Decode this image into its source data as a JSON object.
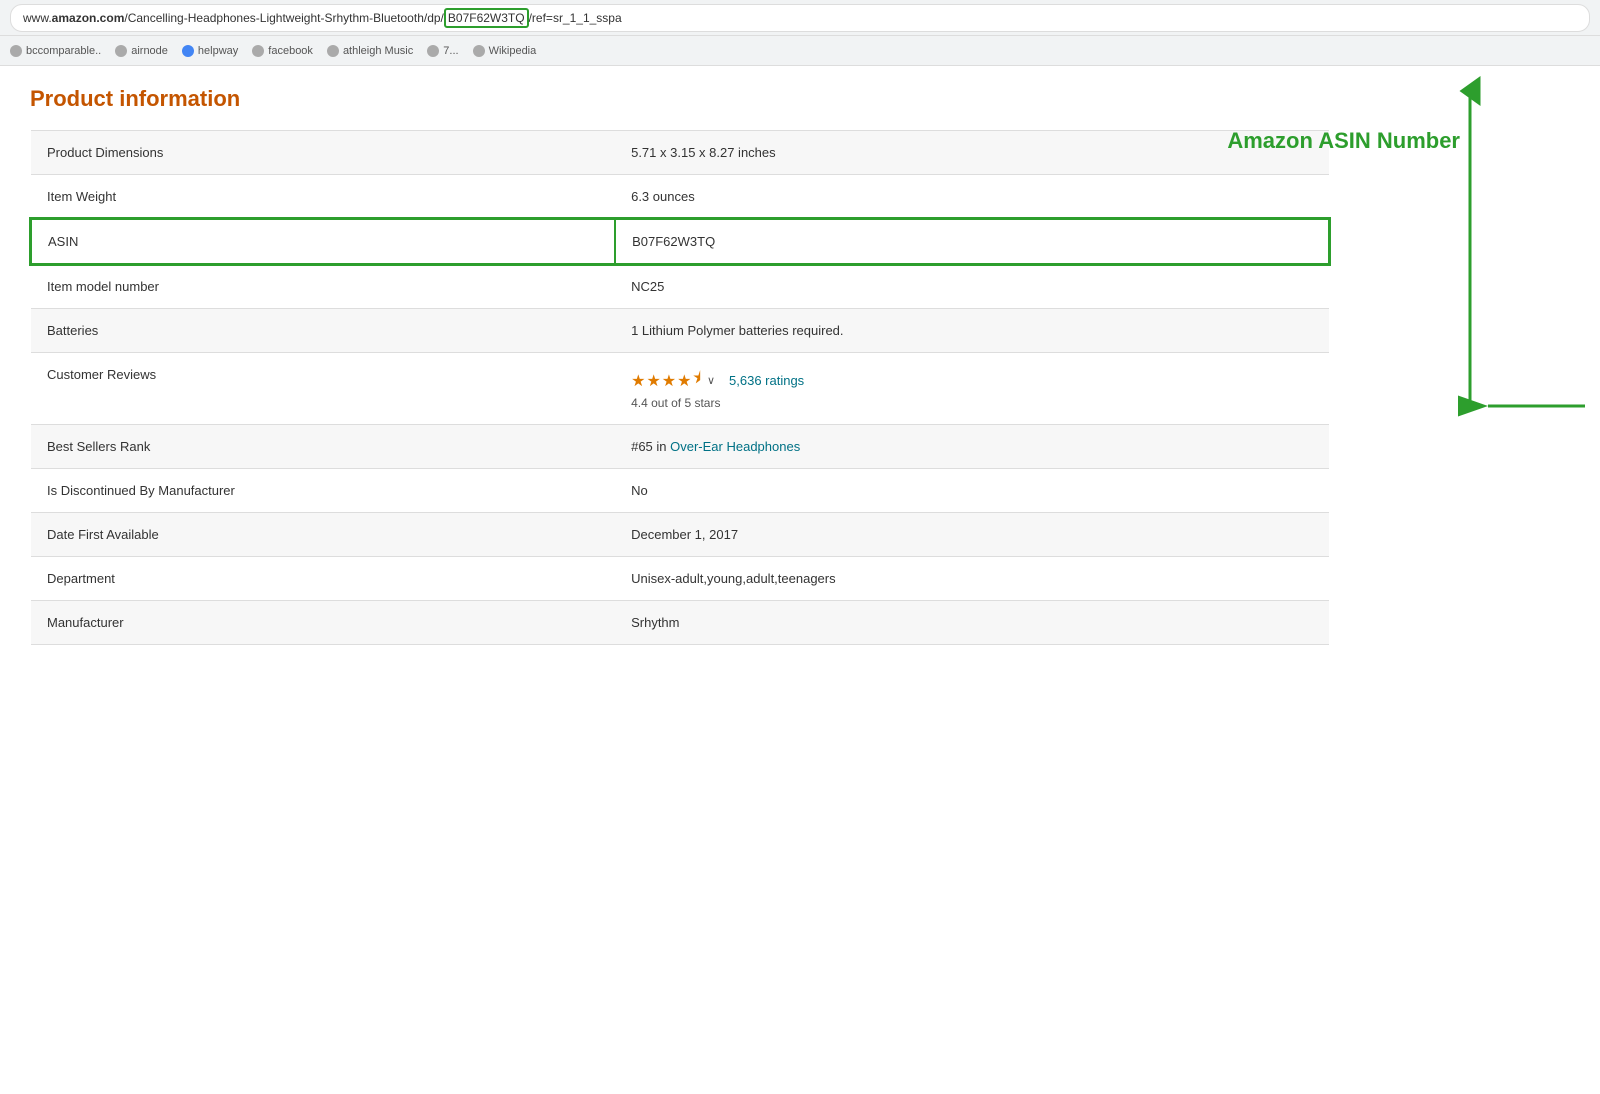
{
  "browser": {
    "url_prefix": "www.",
    "url_domain": "amazon.com",
    "url_path": "/Cancelling-Headphones-Lightweight-Srhythm-Bluetooth/dp/",
    "url_asin": "B07F62W3TQ",
    "url_suffix": "/ref=sr_1_1_sspa",
    "bookmarks": [
      {
        "label": "bccomparable..",
        "dot": "gray"
      },
      {
        "label": "airnode",
        "dot": "gray"
      },
      {
        "label": "helpway",
        "dot": "blue"
      },
      {
        "label": "facebook",
        "dot": "gray"
      },
      {
        "label": "athleigh Music",
        "dot": "gray"
      },
      {
        "label": "7...",
        "dot": "gray"
      },
      {
        "label": "Wikipedia",
        "dot": "gray"
      }
    ]
  },
  "page": {
    "heading": "Product information"
  },
  "table": {
    "rows": [
      {
        "label": "Product Dimensions",
        "value": "5.71 x 3.15 x 8.27 inches"
      },
      {
        "label": "Item Weight",
        "value": "6.3 ounces",
        "highlight": false
      },
      {
        "label": "ASIN",
        "value": "B07F62W3TQ",
        "highlight": true
      },
      {
        "label": "Item model number",
        "value": "NC25"
      },
      {
        "label": "Batteries",
        "value": "1 Lithium Polymer batteries required."
      },
      {
        "label": "Customer Reviews",
        "value_type": "stars",
        "stars": 4,
        "half": true,
        "ratings_count": "5,636 ratings",
        "rating_text": "4.4 out of 5 stars"
      },
      {
        "label": "Best Sellers Rank",
        "value_type": "bsr",
        "rank": "#65",
        "category": "Over-Ear Headphones"
      },
      {
        "label": "Is Discontinued By Manufacturer",
        "value": "No"
      },
      {
        "label": "Date First Available",
        "value": "December 1, 2017"
      },
      {
        "label": "Department",
        "value": "Unisex-adult,young,adult,teenagers"
      },
      {
        "label": "Manufacturer",
        "value": "Srhythm"
      }
    ]
  },
  "annotation": {
    "label": "Amazon ASIN Number"
  },
  "colors": {
    "green": "#2d9e2d",
    "orange_heading": "#c45500",
    "link_blue": "#007185",
    "star_orange": "#e07b00"
  }
}
